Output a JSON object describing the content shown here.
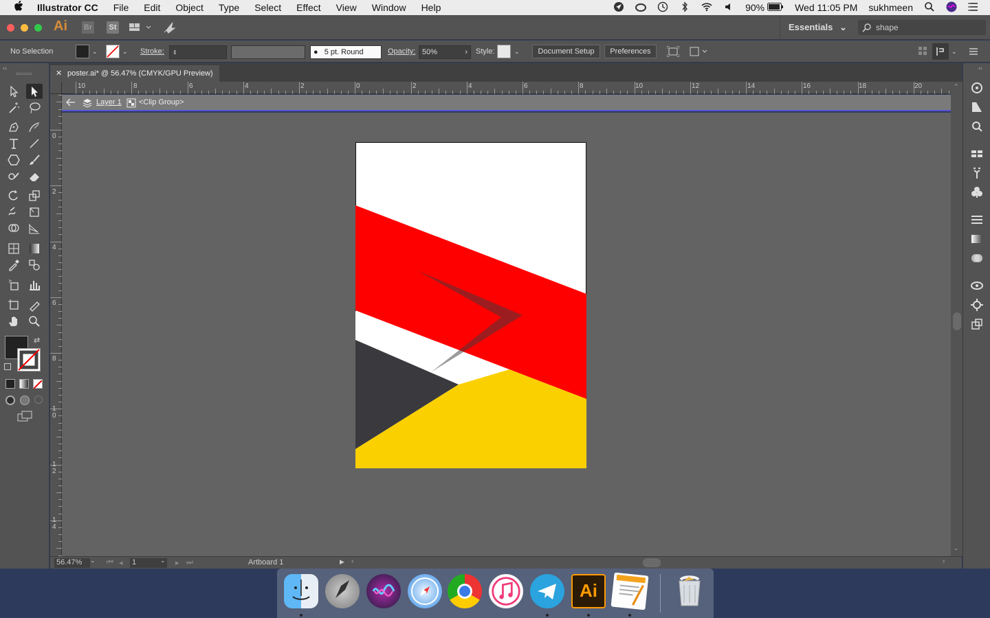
{
  "menubar": {
    "app_name": "Illustrator CC",
    "items": [
      "File",
      "Edit",
      "Object",
      "Type",
      "Select",
      "Effect",
      "View",
      "Window",
      "Help"
    ],
    "battery": "90%",
    "clock": "Wed 11:05 PM",
    "user": "sukhmeen"
  },
  "appbar": {
    "logo": "Ai",
    "bridge": "Br",
    "stock": "St",
    "workspace": "Essentials",
    "search_value": "shape"
  },
  "controlbar": {
    "selection": "No Selection",
    "stroke_label": "Stroke:",
    "brush_value": "5 pt. Round",
    "opacity_label": "Opacity:",
    "opacity_value": "50%",
    "style_label": "Style:",
    "document_setup": "Document Setup",
    "preferences": "Preferences"
  },
  "document": {
    "tab_title": "poster.ai* @ 56.47% (CMYK/GPU Preview)",
    "layer": "Layer 1",
    "group": "<Clip Group>"
  },
  "rulers": {
    "horizontal": [
      "10",
      "8",
      "6",
      "4",
      "2",
      "0",
      "2",
      "4",
      "6",
      "8",
      "10",
      "12",
      "14",
      "16",
      "18",
      "20"
    ],
    "vertical": [
      "0",
      "2",
      "4",
      "6",
      "8",
      "1 0",
      "1 2",
      "1 4"
    ]
  },
  "statusbar": {
    "zoom": "56.47%",
    "page": "1",
    "artboard": "Artboard 1"
  },
  "colors": {
    "poster_red": "#ff0000",
    "poster_yellow": "#fbd000",
    "poster_dark": "#3a393d",
    "isolation_line": "#5a55d6"
  },
  "dock": {
    "apps": [
      "finder-icon",
      "launchpad-icon",
      "siri-icon",
      "safari-icon",
      "chrome-icon",
      "itunes-icon",
      "telegram-icon",
      "illustrator-icon",
      "pages-icon",
      "trash-icon"
    ],
    "illustrator_label": "Ai"
  }
}
